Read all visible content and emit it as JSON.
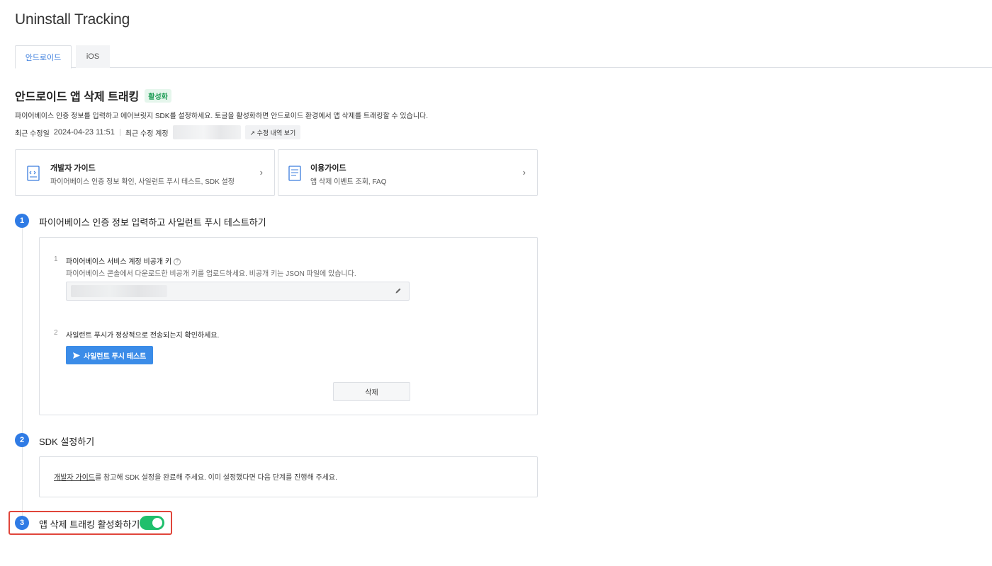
{
  "page": {
    "title": "Uninstall Tracking"
  },
  "tabs": [
    {
      "label": "안드로이드",
      "active": true
    },
    {
      "label": "iOS",
      "active": false
    }
  ],
  "section": {
    "title": "안드로이드 앱 삭제 트래킹",
    "status_badge": "활성화",
    "description": "파이어베이스 인증 정보를 입력하고 에어브릿지 SDK를 설정하세요. 토글을 활성화하면 안드로이드 환경에서 앱 삭제를 트래킹할 수 있습니다."
  },
  "meta": {
    "modified_label": "최근 수정일",
    "modified_date": "2024-04-23 11:51",
    "account_label": "최근 수정 계정",
    "history_button": "↗ 수정 내역 보기"
  },
  "guides": {
    "developer": {
      "title": "개발자 가이드",
      "subtitle": "파이어베이스 인증 정보 확인, 사일런트 푸시 테스트, SDK 설정",
      "arrow": "›"
    },
    "usage": {
      "title": "이용가이드",
      "subtitle": "앱 삭제 이벤트 조회, FAQ",
      "arrow": "›"
    }
  },
  "steps": {
    "step1": {
      "number": "1",
      "title": "파이어베이스 인증 정보 입력하고 사일런트 푸시 테스트하기",
      "sub1": {
        "number": "1",
        "label": "파이어베이스 서비스 계정 비공개 키",
        "help_icon": "?",
        "help": "파이어베이스 콘솔에서 다운로드한 비공개 키를 업로드하세요. 비공개 키는 JSON 파일에 있습니다."
      },
      "sub2": {
        "number": "2",
        "label": "사일런트 푸시가 정상적으로 전송되는지 확인하세요.",
        "test_button": "사일런트 푸시 테스트"
      },
      "delete_button": "삭제"
    },
    "step2": {
      "number": "2",
      "title": "SDK 설정하기",
      "link_text": "개발자 가이드",
      "text": "를 참고해 SDK 설정을 완료해 주세요. 이미 설정했다면 다음 단계를 진행해 주세요."
    },
    "step3": {
      "number": "3",
      "title": "앱 삭제 트래킹 활성화하기",
      "toggle_on": true
    }
  },
  "colors": {
    "accent": "#2f7be5",
    "toggle_on": "#1fbf6c",
    "badge_text": "#1f9d57",
    "highlight": "#e0453a"
  },
  "icons": {
    "guide_developer": "code-document-icon",
    "guide_usage": "document-list-icon",
    "edit": "pencil-icon",
    "send": "paper-plane-icon"
  }
}
